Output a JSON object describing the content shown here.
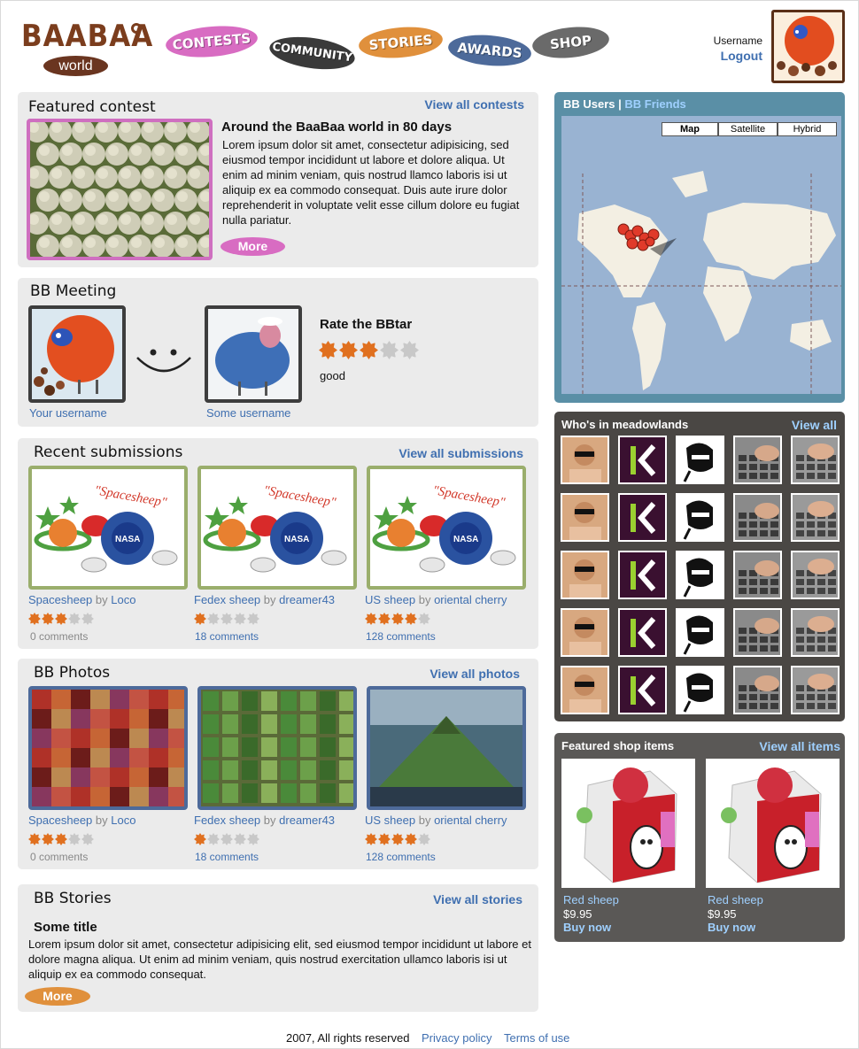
{
  "header": {
    "logo": {
      "word": "BAABAA",
      "sub": "world"
    },
    "nav": [
      {
        "label": "CONTESTS",
        "color": "#d86cc2"
      },
      {
        "label": "COMMUNITY",
        "color": "#3a3a3a"
      },
      {
        "label": "STORIES",
        "color": "#e0903c"
      },
      {
        "label": "AWARDS",
        "color": "#4d6a9a"
      },
      {
        "label": "SHOP",
        "color": "#6a6a6a"
      }
    ],
    "username": "Username",
    "logout": "Logout"
  },
  "featured": {
    "heading": "Featured contest",
    "view_all": "View all contests",
    "title": "Around the BaaBaa world in 80 days",
    "text": "Lorem ipsum dolor sit amet, consectetur adipisicing, sed eiusmod tempor incididunt ut labore et dolore aliqua. Ut enim ad minim veniam, quis nostrud llamco laboris isi ut aliquip ex ea commodo consequat. Duis aute irure dolor reprehenderit in voluptate velit esse cillum dolore eu fugiat nulla pariatur.",
    "more": "More"
  },
  "meeting": {
    "heading": "BB Meeting",
    "left_user": "Your username",
    "right_user": "Some username",
    "rate_title": "Rate the BBtar",
    "rating": 3,
    "rating_text": "good"
  },
  "submissions": {
    "heading": "Recent submissions",
    "view_all": "View all submissions",
    "image_text": "\"Spacesheep\"",
    "items": [
      {
        "title": "Spacesheep",
        "by": "by",
        "author": "Loco",
        "comments": "0 comments",
        "stars": 3
      },
      {
        "title": "Fedex sheep",
        "by": "by",
        "author": "dreamer43",
        "comments": "18 comments",
        "stars": 1
      },
      {
        "title": "US sheep",
        "by": "by",
        "author": "oriental cherry",
        "comments": "128 comments",
        "stars": 4
      }
    ]
  },
  "photos": {
    "heading": "BB Photos",
    "view_all": "View all photos",
    "items": [
      {
        "title": "Spacesheep",
        "by": "by",
        "author": "Loco",
        "comments": "0 comments",
        "stars": 3
      },
      {
        "title": "Fedex sheep",
        "by": "by",
        "author": "dreamer43",
        "comments": "18 comments",
        "stars": 1
      },
      {
        "title": "US sheep",
        "by": "by",
        "author": "oriental cherry",
        "comments": "128 comments",
        "stars": 4
      }
    ]
  },
  "stories": {
    "heading": "BB Stories",
    "view_all": "View all stories",
    "title": "Some title",
    "text": "Lorem ipsum dolor sit amet, consectetur adipisicing elit, sed eiusmod tempor incididunt ut labore et dolore magna aliqua. Ut enim ad minim veniam, quis nostrud exercitation ullamco laboris isi ut aliquip ex ea commodo consequat.",
    "more": "More"
  },
  "map": {
    "tab_users": "BB Users",
    "sep": "|",
    "tab_friends": "BB Friends",
    "types": [
      "Map",
      "Satellite",
      "Hybrid"
    ],
    "selected": "Map"
  },
  "meadow": {
    "heading": "Who's in meadowlands",
    "view_all": "View all"
  },
  "shop": {
    "heading": "Featured shop items",
    "view_all": "View all items",
    "items": [
      {
        "name": "Red sheep",
        "price": "$9.95",
        "buy": "Buy now"
      },
      {
        "name": "Red sheep",
        "price": "$9.95",
        "buy": "Buy now"
      }
    ]
  },
  "footer": {
    "copyright": "2007, All rights reserved",
    "privacy": "Privacy policy",
    "terms": "Terms of use"
  },
  "colors": {
    "star_on": "#e0701f",
    "star_off": "#c8c8c8",
    "link": "#3f6fb0"
  }
}
